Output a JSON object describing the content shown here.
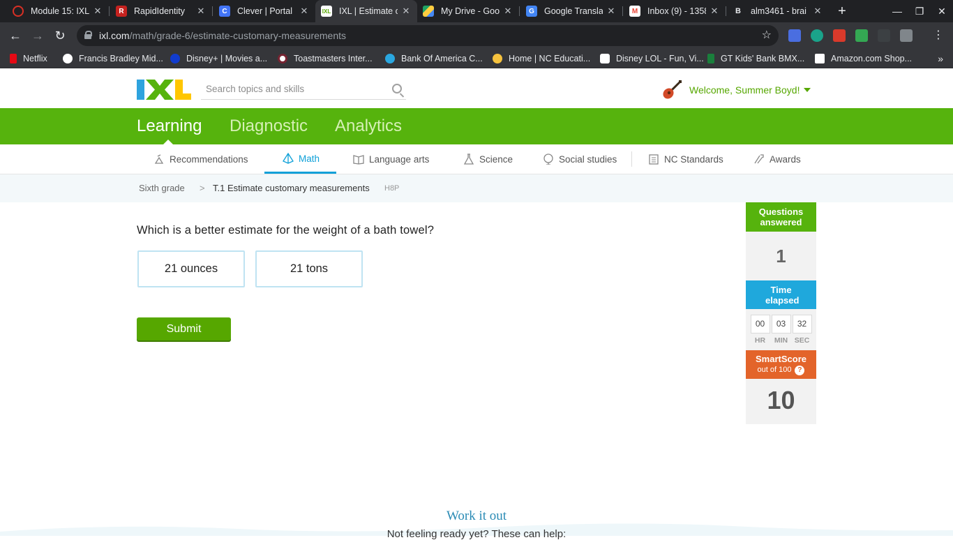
{
  "browser": {
    "tabs": [
      {
        "title": "Module 15: IXL",
        "favicon": "ring-icon",
        "color": "#d93025"
      },
      {
        "title": "RapidIdentity",
        "favicon": "rapididentity-icon",
        "color": "#c5221f"
      },
      {
        "title": "Clever | Portal",
        "favicon": "clever-icon",
        "color": "#4274f6"
      },
      {
        "title": "IXL | Estimate c",
        "favicon": "ixl-icon",
        "color": "#56a700"
      },
      {
        "title": "My Drive - Goog",
        "favicon": "drive-icon",
        "color": "#1fa463"
      },
      {
        "title": "Google Transla",
        "favicon": "translate-icon",
        "color": "#4285f4"
      },
      {
        "title": "Inbox (9) - 1358",
        "favicon": "gmail-icon",
        "color": "#ea4335"
      },
      {
        "title": "alm3461 - brai",
        "favicon": "brainly-icon",
        "color": "#202124"
      }
    ],
    "url_domain": "ixl.com",
    "url_path": "/math/grade-6/estimate-customary-measurements",
    "bookmarks": [
      {
        "label": "Netflix",
        "color": "#e50914"
      },
      {
        "label": "Francis Bradley Mid...",
        "color": "#ffffff"
      },
      {
        "label": "Disney+ | Movies a...",
        "color": "#113ccf"
      },
      {
        "label": "Toastmasters Inter...",
        "color": "#ffffff"
      },
      {
        "label": "Bank Of America C...",
        "color": "#2aa7e0"
      },
      {
        "label": "Home | NC Educati...",
        "color": "#f6c23e"
      },
      {
        "label": "Disney LOL - Fun, Vi...",
        "color": "#ffffff"
      },
      {
        "label": "GT Kids' Bank BMX...",
        "color": "#1a7f3c"
      },
      {
        "label": "Amazon.com Shop...",
        "color": "#ffffff"
      }
    ]
  },
  "ixl": {
    "search_placeholder": "Search topics and skills",
    "welcome": "Welcome, Summer Boyd!",
    "main_nav": [
      "Learning",
      "Diagnostic",
      "Analytics"
    ],
    "sub_nav": [
      "Recommendations",
      "Math",
      "Language arts",
      "Science",
      "Social studies",
      "NC Standards",
      "Awards"
    ],
    "breadcrumb": {
      "grade": "Sixth grade",
      "skill": "T.1 Estimate customary measurements",
      "code": "H8P"
    },
    "question": "Which is a better estimate for the weight of a bath towel?",
    "choices": [
      "21 ounces",
      "21 tons"
    ],
    "submit_label": "Submit",
    "stats": {
      "questions_answered_label": "Questions answered",
      "questions_answered": "1",
      "time_elapsed_label": "Time elapsed",
      "time": {
        "hr": "00",
        "min": "03",
        "sec": "32"
      },
      "time_units": {
        "hr": "HR",
        "min": "MIN",
        "sec": "SEC"
      },
      "smartscore_label": "SmartScore",
      "smartscore_sub": "out of 100",
      "smartscore_help": "?",
      "smartscore": "10"
    },
    "work_it_out": "Work it out",
    "not_ready": "Not feeling ready yet? These can help:"
  },
  "colors": {
    "ixl_green": "#56b30d",
    "ixl_blue": "#1fa8dc",
    "smartscore_orange": "#e3642a"
  }
}
